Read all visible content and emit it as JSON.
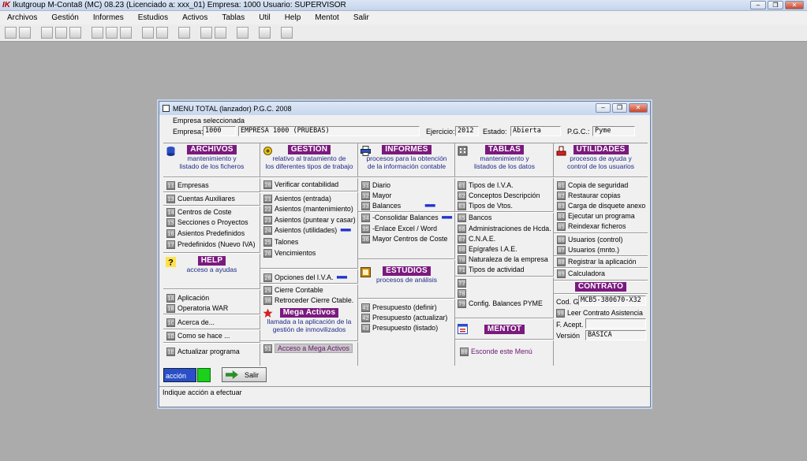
{
  "app": {
    "title": "Ikutgroup M-Conta8 (MC) 08.23  (Licenciado a: xxx_01)  Empresa: 1000  Usuario: SUPERVISOR",
    "logo": "IK"
  },
  "menu": [
    "Archivos",
    "Gestión",
    "Informes",
    "Estudios",
    "Activos",
    "Tablas",
    "Util",
    "Help",
    "Mentot",
    "Salir"
  ],
  "window_buttons": {
    "minimize": "–",
    "restore": "❐",
    "close": "✕"
  },
  "dialog": {
    "title": "MENU TOTAL (lanzador) P.G.C. 2008",
    "empresa_section": "Empresa seleccionada",
    "empresa_label": "Empresa:",
    "empresa_code": "1000",
    "empresa_name": "EMPRESA 1000 (PRUEBAS)",
    "ejercicio_label": "Ejercicio:",
    "ejercicio_value": "2012",
    "estado_label": "Estado:",
    "estado_value": "Abierta",
    "pgc_label": "P.G.C.:",
    "pgc_value": "Pyme"
  },
  "archivos": {
    "title": "ARCHIVOS",
    "sub1": "mantenimiento y",
    "sub2": "listado de los ficheros",
    "items": [
      {
        "num": "11",
        "label": "Empresas"
      },
      {
        "num": "13",
        "label": "Cuentas Auxiliares"
      },
      {
        "num": "14",
        "label": "Centros de Coste"
      },
      {
        "num": "15",
        "label": "Secciones o Proyectos"
      },
      {
        "num": "16",
        "label": "Asientos Predefinidos"
      },
      {
        "num": "17",
        "label": "Predefinidos (Nuevo IVA)"
      }
    ]
  },
  "help": {
    "title": "HELP",
    "sub1": "acceso a ayudas",
    "items": [
      {
        "num": "1A",
        "label": "Aplicación"
      },
      {
        "num": "1B",
        "label": "Operatoria WAR"
      },
      {
        "num": "1C",
        "label": "Acerca de..."
      },
      {
        "num": "1D",
        "label": "Como se hace ..."
      },
      {
        "num": "1E",
        "label": "Actualizar programa"
      }
    ]
  },
  "gestion": {
    "title": "GESTIÓN",
    "sub1": "relativo al tratamiento de",
    "sub2": "los diferentes tipos de trabajo",
    "items": [
      {
        "num": "20",
        "label": "Verificar contabilidad"
      },
      {
        "num": "21",
        "label": "Asientos (entrada)"
      },
      {
        "num": "22",
        "label": "Asientos (mantenimiento)"
      },
      {
        "num": "23",
        "label": "Asientos (puntear y casar)"
      },
      {
        "num": "24",
        "label": "Asientos (utilidades)"
      },
      {
        "num": "25",
        "label": "Talones"
      },
      {
        "num": "26",
        "label": "Vencimientos"
      },
      {
        "num": "28",
        "label": "Opciones del I.V.A."
      },
      {
        "num": "29",
        "label": "Cierre Contable"
      },
      {
        "num": "30",
        "label": "Retroceder Cierre Ctable."
      }
    ]
  },
  "mega_activos": {
    "title": "Mega Activos",
    "sub1": "llamada a la aplicación de la",
    "sub2": "gestión de inmovilizados",
    "items": [
      {
        "num": "51",
        "label": "Acceso a Mega Activos"
      }
    ]
  },
  "informes": {
    "title": "INFORMES",
    "sub1": "procesos para la obtención",
    "sub2": "de la información contable",
    "items": [
      {
        "num": "31",
        "label": "Diario"
      },
      {
        "num": "32",
        "label": "Mayor"
      },
      {
        "num": "33",
        "label": "Balances"
      },
      {
        "num": "34",
        "label": "-Consolidar Balances"
      },
      {
        "num": "35",
        "label": "-Enlace Excel / Word"
      },
      {
        "num": "36",
        "label": "Mayor Centros de Coste"
      }
    ]
  },
  "estudios": {
    "title": "ESTUDIOS",
    "sub1": "procesos de análisis",
    "items": [
      {
        "num": "41",
        "label": "Presupuesto (definir)"
      },
      {
        "num": "42",
        "label": "Presupuesto (actualizar)"
      },
      {
        "num": "43",
        "label": "Presupuesto (listado)"
      }
    ]
  },
  "tablas": {
    "title": "TABLAS",
    "sub1": "mantenimiento y",
    "sub2": "listados de los datos",
    "items": [
      {
        "num": "61",
        "label": "Tipos de I.V.A."
      },
      {
        "num": "62",
        "label": "Conceptos Descripción"
      },
      {
        "num": "63",
        "label": "Tipos de Vtos."
      },
      {
        "num": "65",
        "label": "Bancos"
      },
      {
        "num": "66",
        "label": "Administraciones de Hcda."
      },
      {
        "num": "67",
        "label": "C.N.A.E."
      },
      {
        "num": "68",
        "label": "Epígrafes I.A.E."
      },
      {
        "num": "70",
        "label": "Naturaleza de la empresa"
      },
      {
        "num": "71",
        "label": "Tipos de actividad"
      },
      {
        "num": "77",
        "label": ""
      },
      {
        "num": "78",
        "label": ""
      },
      {
        "num": "79",
        "label": "Config. Balances PYME"
      }
    ]
  },
  "mentot": {
    "title": "MENTOT",
    "items": [
      {
        "num": "80",
        "label": "Esconde este Menú"
      }
    ]
  },
  "utilidades": {
    "title": "UTILIDADES",
    "sub1": "procesos de ayuda y",
    "sub2": "control de los usuarios",
    "items": [
      {
        "num": "81",
        "label": "Copia de seguridad"
      },
      {
        "num": "82",
        "label": "Restaurar copias"
      },
      {
        "num": "83",
        "label": "Carga de disquete anexo"
      },
      {
        "num": "84",
        "label": "Ejecutar un programa"
      },
      {
        "num": "85",
        "label": "Reindexar ficheros"
      },
      {
        "num": "86",
        "label": "Usuarios (control)"
      },
      {
        "num": "87",
        "label": "Usuarios (mnto.)"
      },
      {
        "num": "88",
        "label": "Registrar la aplicación"
      },
      {
        "num": "89",
        "label": "Calculadora"
      }
    ]
  },
  "contrato": {
    "title": "CONTRATO",
    "cod_label": "Cod. G.",
    "cod_value": "MCB5-380670-X32",
    "leer_num": "99",
    "leer_label": "Leer Contrato Asistencia",
    "facept_label": "F. Acept.",
    "facept_value": "",
    "version_label": "Versión",
    "version_value": "BÁSICA"
  },
  "bottom": {
    "accion_label": "acción",
    "salir_label": "Salir",
    "status": "Indique acción a efectuar"
  },
  "colors": {
    "badge": "#7b1a7e",
    "subtitle": "#1f2a8a",
    "accion": "#2a4fc8",
    "green": "#1cd11c"
  }
}
